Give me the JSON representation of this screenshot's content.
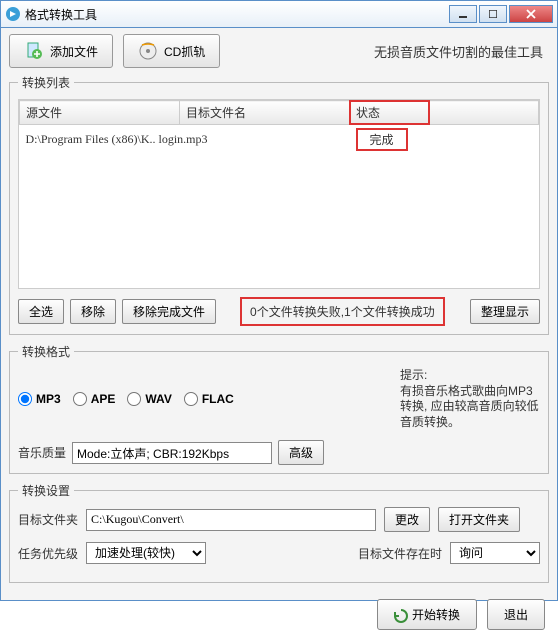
{
  "window": {
    "title": "格式转换工具"
  },
  "toolbar": {
    "add_file": "添加文件",
    "cd_rip": "CD抓轨",
    "slogan": "无损音质文件切割的最佳工具"
  },
  "list": {
    "legend": "转换列表",
    "headers": {
      "source": "源文件",
      "target": "目标文件名",
      "status": "状态"
    },
    "rows": [
      {
        "source": "D:\\Program Files (x86)\\K.. login.mp3",
        "target": "",
        "status": "完成"
      }
    ],
    "buttons": {
      "select_all": "全选",
      "remove": "移除",
      "remove_done": "移除完成文件",
      "tidy": "整理显示"
    },
    "status_msg": "0个文件转换失败,1个文件转换成功"
  },
  "format": {
    "legend": "转换格式",
    "options": {
      "mp3": "MP3",
      "ape": "APE",
      "wav": "WAV",
      "flac": "FLAC"
    },
    "selected": "mp3",
    "hint_title": "提示:",
    "hint_body": "有损音乐格式歌曲向MP3转换, 应由较高音质向较低音质转换。",
    "quality_label": "音乐质量",
    "quality_value": "Mode:立体声; CBR:192Kbps",
    "advanced": "高级"
  },
  "settings": {
    "legend": "转换设置",
    "folder_label": "目标文件夹",
    "folder_value": "C:\\Kugou\\Convert\\",
    "change": "更改",
    "open": "打开文件夹",
    "priority_label": "任务优先级",
    "priority_value": "加速处理(较快)",
    "exists_label": "目标文件存在时",
    "exists_value": "询问"
  },
  "footer": {
    "start": "开始转换",
    "exit": "退出"
  }
}
